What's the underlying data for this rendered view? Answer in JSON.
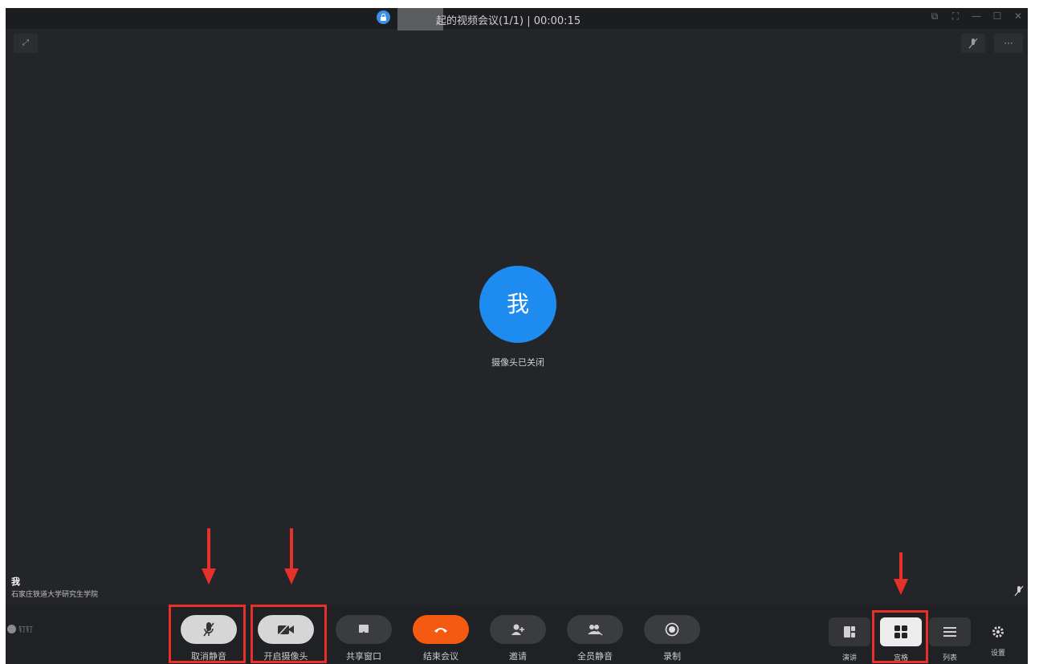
{
  "titlebar": {
    "title": "起的视频会议(1/1) | 00:00:15",
    "controls": [
      "pin-icon",
      "fullscreen-icon",
      "minimize-icon",
      "maximize-icon",
      "close-icon"
    ]
  },
  "stage": {
    "avatar_text": "我",
    "camera_status": "摄像头已关闭",
    "self_name": "我",
    "self_org": "石家庄铁道大学研究生学院"
  },
  "toolbar": {
    "logo_text": "钉钉",
    "buttons": {
      "unmute": "取消静音",
      "camera_on": "开启摄像头",
      "share": "共享窗口",
      "end": "结束会议",
      "invite": "邀请",
      "mute_all": "全员静音",
      "record": "录制"
    },
    "views": {
      "speaker": "演讲",
      "grid": "宫格",
      "list": "列表",
      "settings": "设置"
    },
    "active_view": "grid"
  },
  "colors": {
    "window_bg": "#232528",
    "avatar": "#1e8bf0",
    "end_button": "#f45a12",
    "annotation": "#e8302a"
  }
}
